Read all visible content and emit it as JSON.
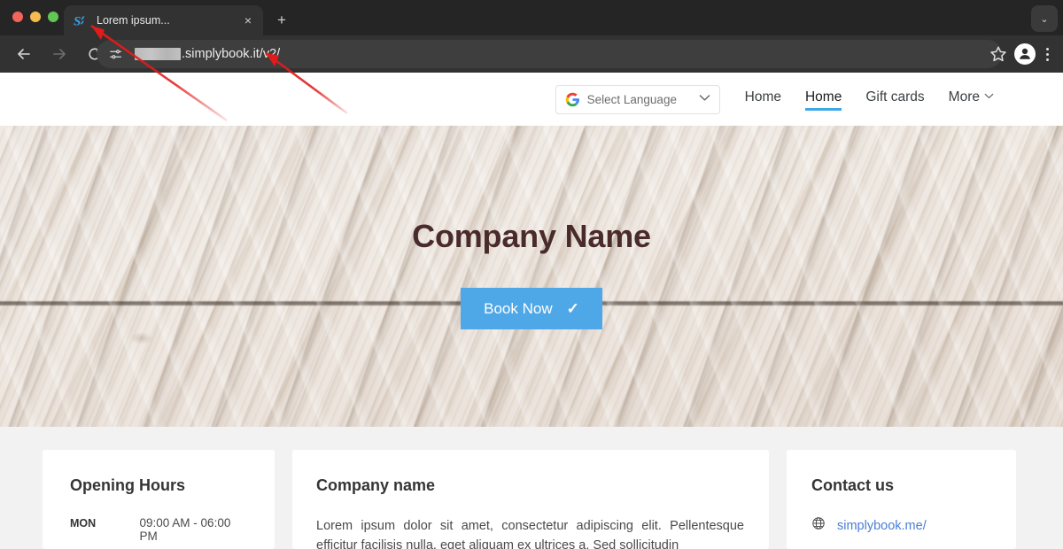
{
  "browser": {
    "window_controls": [
      "close",
      "minimize",
      "maximize"
    ],
    "tab": {
      "title": "Lorem ipsum...",
      "favicon": "simplybook-s-icon",
      "close_label": "×"
    },
    "new_tab_label": "+",
    "tabstrip_chevron": "⌄",
    "toolbar": {
      "back_label": "←",
      "forward_label": "→",
      "reload_label": "↻",
      "site_info_icon": "tune-icon",
      "url_prefix_redacted": true,
      "url_text": ".simplybook.it/v2/",
      "bookmark_icon": "star-icon",
      "profile_icon": "person-icon",
      "menu_icon": "kebab-menu-icon"
    }
  },
  "site": {
    "header": {
      "language_selector": {
        "label": "Select Language",
        "icon": "google-g-icon",
        "caret": "⌄"
      },
      "nav": [
        {
          "label": "Home",
          "active": false,
          "caret": ""
        },
        {
          "label": "Home",
          "active": true,
          "caret": ""
        },
        {
          "label": "Gift cards",
          "active": false,
          "caret": ""
        },
        {
          "label": "More",
          "active": false,
          "caret": "⌄"
        }
      ]
    },
    "hero": {
      "title": "Company Name",
      "button_label": "Book Now",
      "button_check": "✓",
      "button_color": "#4ea7e6",
      "title_color": "#4a2b2b"
    },
    "cards": {
      "opening_hours": {
        "title": "Opening Hours",
        "rows": [
          {
            "day": "MON",
            "time": "09:00 AM - 06:00 PM"
          }
        ]
      },
      "company": {
        "title": "Company name",
        "text": "Lorem ipsum dolor sit amet, consectetur adipiscing elit. Pellentesque efficitur facilisis nulla, eget aliquam ex ultrices a. Sed sollicitudin"
      },
      "contact": {
        "title": "Contact us",
        "icon": "globe-icon",
        "link_text": "simplybook.me/",
        "link_color": "#4a7fd4"
      }
    }
  },
  "annotations": {
    "color": "#e11b1b",
    "arrows": [
      {
        "name": "arrow-to-tab-favicon",
        "points_to": "tab favicon"
      },
      {
        "name": "arrow-to-url",
        "points_to": "address bar url"
      }
    ]
  }
}
